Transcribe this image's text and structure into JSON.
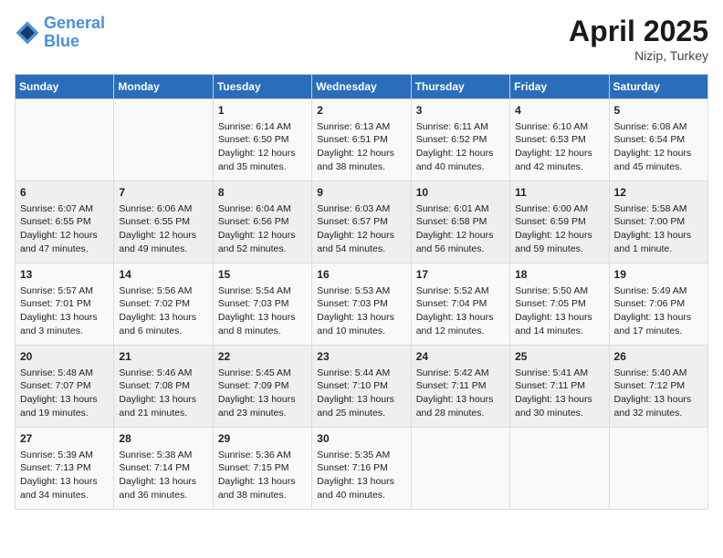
{
  "header": {
    "logo_text_general": "General",
    "logo_text_blue": "Blue",
    "month_title": "April 2025",
    "subtitle": "Nizip, Turkey"
  },
  "calendar": {
    "days_of_week": [
      "Sunday",
      "Monday",
      "Tuesday",
      "Wednesday",
      "Thursday",
      "Friday",
      "Saturday"
    ],
    "weeks": [
      [
        {
          "day": "",
          "info": ""
        },
        {
          "day": "",
          "info": ""
        },
        {
          "day": "1",
          "info": "Sunrise: 6:14 AM\nSunset: 6:50 PM\nDaylight: 12 hours and 35 minutes."
        },
        {
          "day": "2",
          "info": "Sunrise: 6:13 AM\nSunset: 6:51 PM\nDaylight: 12 hours and 38 minutes."
        },
        {
          "day": "3",
          "info": "Sunrise: 6:11 AM\nSunset: 6:52 PM\nDaylight: 12 hours and 40 minutes."
        },
        {
          "day": "4",
          "info": "Sunrise: 6:10 AM\nSunset: 6:53 PM\nDaylight: 12 hours and 42 minutes."
        },
        {
          "day": "5",
          "info": "Sunrise: 6:08 AM\nSunset: 6:54 PM\nDaylight: 12 hours and 45 minutes."
        }
      ],
      [
        {
          "day": "6",
          "info": "Sunrise: 6:07 AM\nSunset: 6:55 PM\nDaylight: 12 hours and 47 minutes."
        },
        {
          "day": "7",
          "info": "Sunrise: 6:06 AM\nSunset: 6:55 PM\nDaylight: 12 hours and 49 minutes."
        },
        {
          "day": "8",
          "info": "Sunrise: 6:04 AM\nSunset: 6:56 PM\nDaylight: 12 hours and 52 minutes."
        },
        {
          "day": "9",
          "info": "Sunrise: 6:03 AM\nSunset: 6:57 PM\nDaylight: 12 hours and 54 minutes."
        },
        {
          "day": "10",
          "info": "Sunrise: 6:01 AM\nSunset: 6:58 PM\nDaylight: 12 hours and 56 minutes."
        },
        {
          "day": "11",
          "info": "Sunrise: 6:00 AM\nSunset: 6:59 PM\nDaylight: 12 hours and 59 minutes."
        },
        {
          "day": "12",
          "info": "Sunrise: 5:58 AM\nSunset: 7:00 PM\nDaylight: 13 hours and 1 minute."
        }
      ],
      [
        {
          "day": "13",
          "info": "Sunrise: 5:57 AM\nSunset: 7:01 PM\nDaylight: 13 hours and 3 minutes."
        },
        {
          "day": "14",
          "info": "Sunrise: 5:56 AM\nSunset: 7:02 PM\nDaylight: 13 hours and 6 minutes."
        },
        {
          "day": "15",
          "info": "Sunrise: 5:54 AM\nSunset: 7:03 PM\nDaylight: 13 hours and 8 minutes."
        },
        {
          "day": "16",
          "info": "Sunrise: 5:53 AM\nSunset: 7:03 PM\nDaylight: 13 hours and 10 minutes."
        },
        {
          "day": "17",
          "info": "Sunrise: 5:52 AM\nSunset: 7:04 PM\nDaylight: 13 hours and 12 minutes."
        },
        {
          "day": "18",
          "info": "Sunrise: 5:50 AM\nSunset: 7:05 PM\nDaylight: 13 hours and 14 minutes."
        },
        {
          "day": "19",
          "info": "Sunrise: 5:49 AM\nSunset: 7:06 PM\nDaylight: 13 hours and 17 minutes."
        }
      ],
      [
        {
          "day": "20",
          "info": "Sunrise: 5:48 AM\nSunset: 7:07 PM\nDaylight: 13 hours and 19 minutes."
        },
        {
          "day": "21",
          "info": "Sunrise: 5:46 AM\nSunset: 7:08 PM\nDaylight: 13 hours and 21 minutes."
        },
        {
          "day": "22",
          "info": "Sunrise: 5:45 AM\nSunset: 7:09 PM\nDaylight: 13 hours and 23 minutes."
        },
        {
          "day": "23",
          "info": "Sunrise: 5:44 AM\nSunset: 7:10 PM\nDaylight: 13 hours and 25 minutes."
        },
        {
          "day": "24",
          "info": "Sunrise: 5:42 AM\nSunset: 7:11 PM\nDaylight: 13 hours and 28 minutes."
        },
        {
          "day": "25",
          "info": "Sunrise: 5:41 AM\nSunset: 7:11 PM\nDaylight: 13 hours and 30 minutes."
        },
        {
          "day": "26",
          "info": "Sunrise: 5:40 AM\nSunset: 7:12 PM\nDaylight: 13 hours and 32 minutes."
        }
      ],
      [
        {
          "day": "27",
          "info": "Sunrise: 5:39 AM\nSunset: 7:13 PM\nDaylight: 13 hours and 34 minutes."
        },
        {
          "day": "28",
          "info": "Sunrise: 5:38 AM\nSunset: 7:14 PM\nDaylight: 13 hours and 36 minutes."
        },
        {
          "day": "29",
          "info": "Sunrise: 5:36 AM\nSunset: 7:15 PM\nDaylight: 13 hours and 38 minutes."
        },
        {
          "day": "30",
          "info": "Sunrise: 5:35 AM\nSunset: 7:16 PM\nDaylight: 13 hours and 40 minutes."
        },
        {
          "day": "",
          "info": ""
        },
        {
          "day": "",
          "info": ""
        },
        {
          "day": "",
          "info": ""
        }
      ]
    ]
  }
}
